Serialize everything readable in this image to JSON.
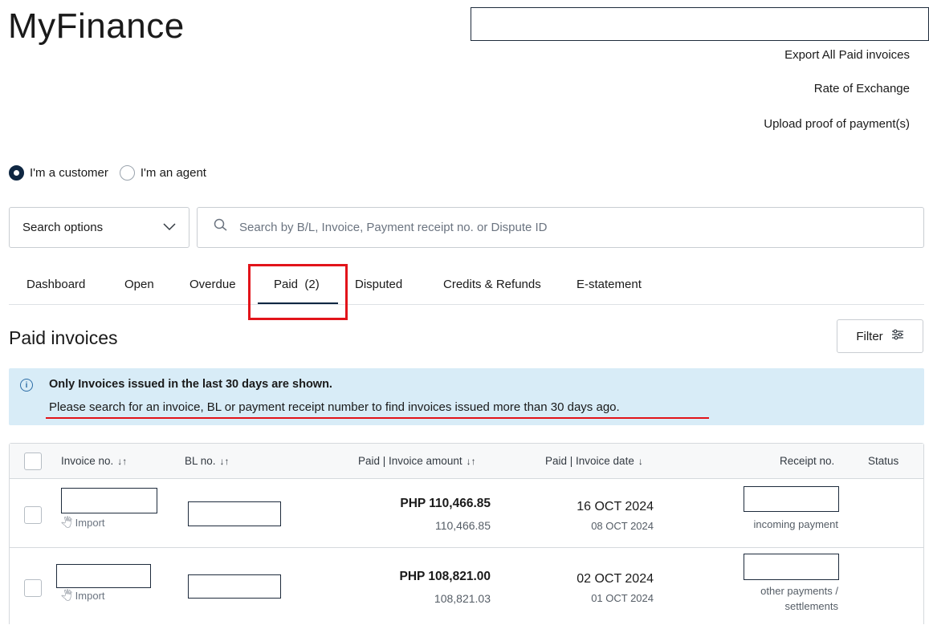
{
  "app": {
    "title": "MyFinance"
  },
  "header_links": {
    "export_paid": "Export All Paid invoices",
    "rate_of_exchange": "Rate of Exchange",
    "upload_proof": "Upload proof of payment(s)"
  },
  "role": {
    "customer_label": "I'm a customer",
    "agent_label": "I'm an agent",
    "selected": "customer"
  },
  "search": {
    "options_label": "Search options",
    "placeholder": "Search by B/L, Invoice, Payment receipt no. or Dispute ID"
  },
  "tabs": [
    {
      "label": "Dashboard",
      "active": false
    },
    {
      "label": "Open",
      "active": false
    },
    {
      "label": "Overdue",
      "active": false
    },
    {
      "label": "Paid  (2)",
      "active": true
    },
    {
      "label": "Disputed",
      "active": false
    },
    {
      "label": "Credits & Refunds",
      "active": false
    },
    {
      "label": "E-statement",
      "active": false
    }
  ],
  "section": {
    "title": "Paid invoices",
    "filter_label": "Filter"
  },
  "banner": {
    "title": "Only Invoices issued in the last 30 days are shown.",
    "text": "Please search for an invoice, BL or payment receipt number to find invoices issued more than 30 days ago."
  },
  "table": {
    "columns": {
      "invoice_no": "Invoice no.",
      "bl_no": "BL no.",
      "amount": "Paid | Invoice amount",
      "date": "Paid | Invoice date",
      "receipt_no": "Receipt no.",
      "status": "Status"
    },
    "rows": [
      {
        "type_label": "Import",
        "paid_amount": "PHP 110,466.85",
        "invoice_amount": "110,466.85",
        "paid_date": "16 OCT 2024",
        "invoice_date": "08 OCT 2024",
        "receipt_note": "incoming payment"
      },
      {
        "type_label": "Import",
        "paid_amount": "PHP 108,821.00",
        "invoice_amount": "108,821.03",
        "paid_date": "02 OCT 2024",
        "invoice_date": "01 OCT 2024",
        "receipt_note": "other payments / settlements"
      }
    ]
  },
  "colors": {
    "primary": "#0f2742",
    "banner_bg": "#d8ecf7",
    "annotation_red": "#e2141a"
  }
}
